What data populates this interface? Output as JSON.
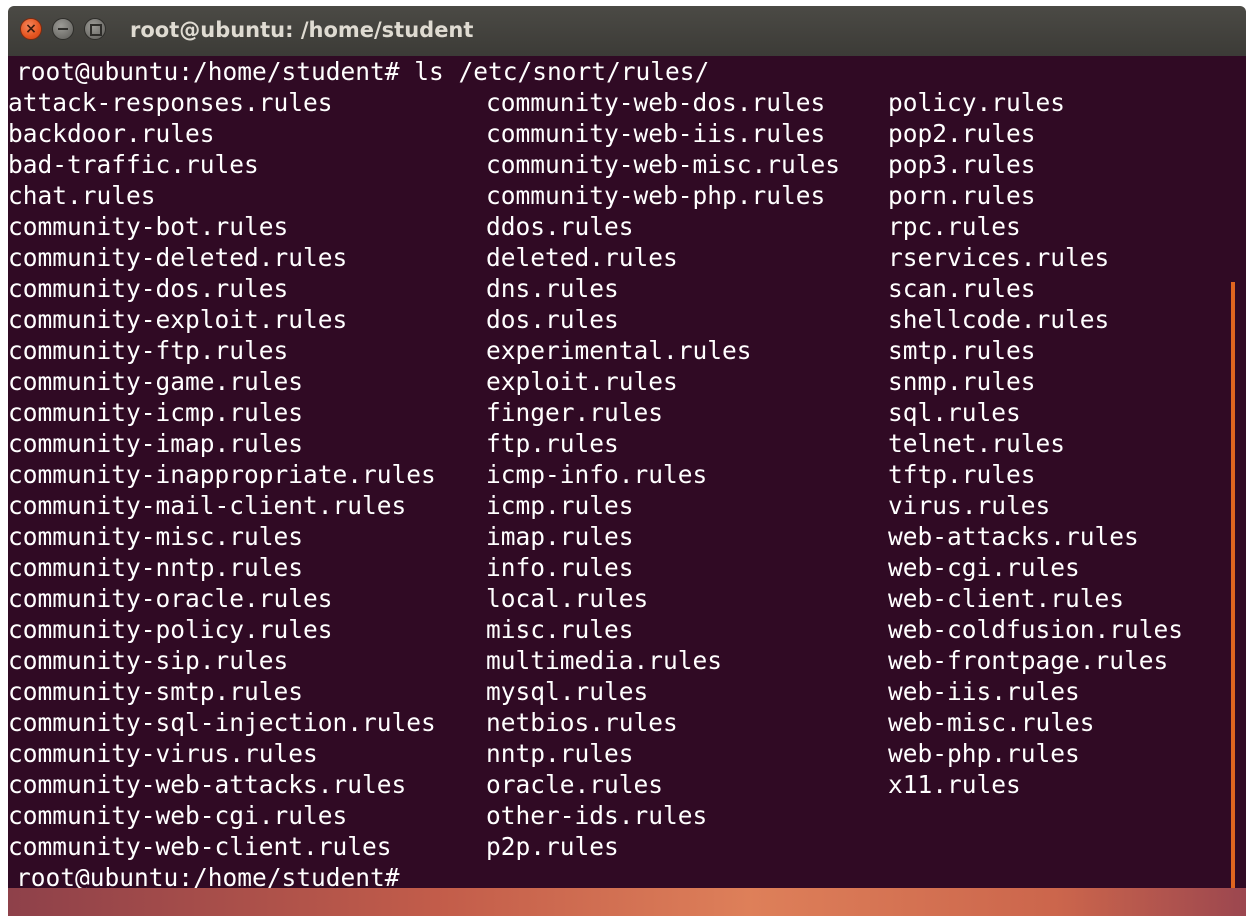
{
  "window": {
    "title": "root@ubuntu: /home/student"
  },
  "terminal": {
    "prompt_command": "root@ubuntu:/home/student# ls /etc/snort/rules/",
    "prompt_final": "root@ubuntu:/home/student#",
    "columns": [
      [
        "attack-responses.rules",
        "backdoor.rules",
        "bad-traffic.rules",
        "chat.rules",
        "community-bot.rules",
        "community-deleted.rules",
        "community-dos.rules",
        "community-exploit.rules",
        "community-ftp.rules",
        "community-game.rules",
        "community-icmp.rules",
        "community-imap.rules",
        "community-inappropriate.rules",
        "community-mail-client.rules",
        "community-misc.rules",
        "community-nntp.rules",
        "community-oracle.rules",
        "community-policy.rules",
        "community-sip.rules",
        "community-smtp.rules",
        "community-sql-injection.rules",
        "community-virus.rules",
        "community-web-attacks.rules",
        "community-web-cgi.rules",
        "community-web-client.rules"
      ],
      [
        "community-web-dos.rules",
        "community-web-iis.rules",
        "community-web-misc.rules",
        "community-web-php.rules",
        "ddos.rules",
        "deleted.rules",
        "dns.rules",
        "dos.rules",
        "experimental.rules",
        "exploit.rules",
        "finger.rules",
        "ftp.rules",
        "icmp-info.rules",
        "icmp.rules",
        "imap.rules",
        "info.rules",
        "local.rules",
        "misc.rules",
        "multimedia.rules",
        "mysql.rules",
        "netbios.rules",
        "nntp.rules",
        "oracle.rules",
        "other-ids.rules",
        "p2p.rules"
      ],
      [
        "policy.rules",
        "pop2.rules",
        "pop3.rules",
        "porn.rules",
        "rpc.rules",
        "rservices.rules",
        "scan.rules",
        "shellcode.rules",
        "smtp.rules",
        "snmp.rules",
        "sql.rules",
        "telnet.rules",
        "tftp.rules",
        "virus.rules",
        "web-attacks.rules",
        "web-cgi.rules",
        "web-client.rules",
        "web-coldfusion.rules",
        "web-frontpage.rules",
        "web-iis.rules",
        "web-misc.rules",
        "web-php.rules",
        "x11.rules"
      ]
    ]
  },
  "colors": {
    "terminal_bg": "#300a24",
    "text": "#ffffff",
    "titlebar": "#3c3b37",
    "close_button": "#e5541f"
  },
  "icons": {
    "close": "close-icon",
    "minimize": "minimize-icon",
    "maximize": "maximize-icon"
  }
}
